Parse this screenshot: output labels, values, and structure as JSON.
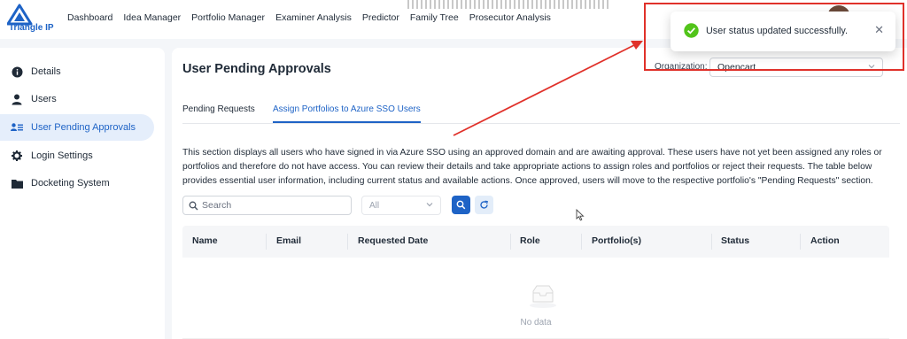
{
  "brand": {
    "name": "Triangle IP",
    "accent": "#1e63c6"
  },
  "nav": [
    "Dashboard",
    "Idea Manager",
    "Portfolio Manager",
    "Examiner Analysis",
    "Predictor",
    "Family Tree",
    "Prosecutor Analysis"
  ],
  "sidebar": {
    "items": [
      {
        "label": "Details",
        "icon": "info-icon"
      },
      {
        "label": "Users",
        "icon": "user-icon"
      },
      {
        "label": "User Pending Approvals",
        "icon": "user-list-icon",
        "active": true
      },
      {
        "label": "Login Settings",
        "icon": "gear-icon"
      },
      {
        "label": "Docketing System",
        "icon": "folder-icon"
      }
    ]
  },
  "page": {
    "title": "User Pending Approvals",
    "organization_label": "Organization:",
    "organization_value": "Opencart"
  },
  "tabs": [
    {
      "label": "Pending Requests"
    },
    {
      "label": "Assign Portfolios to Azure SSO Users",
      "active": true
    }
  ],
  "description": "This section displays all users who have signed in via Azure SSO using an approved domain and are awaiting approval. These users have not yet been assigned any roles or portfolios and therefore do not have access. You can review their details and take appropriate actions to assign roles and portfolios or reject their requests. The table below provides essential user information, including current status and available actions. Once approved, users will move to the respective portfolio's \"Pending Requests\" section.",
  "filters": {
    "search_placeholder": "Search",
    "status_value": "All"
  },
  "table": {
    "columns": [
      "Name",
      "Email",
      "Requested Date",
      "Role",
      "Portfolio(s)",
      "Status",
      "Action"
    ],
    "rows": [],
    "empty_text": "No data"
  },
  "toast": {
    "message": "User status updated successfully.",
    "type": "success",
    "color": "#52c41a"
  },
  "annotation_color": "#e0312a"
}
